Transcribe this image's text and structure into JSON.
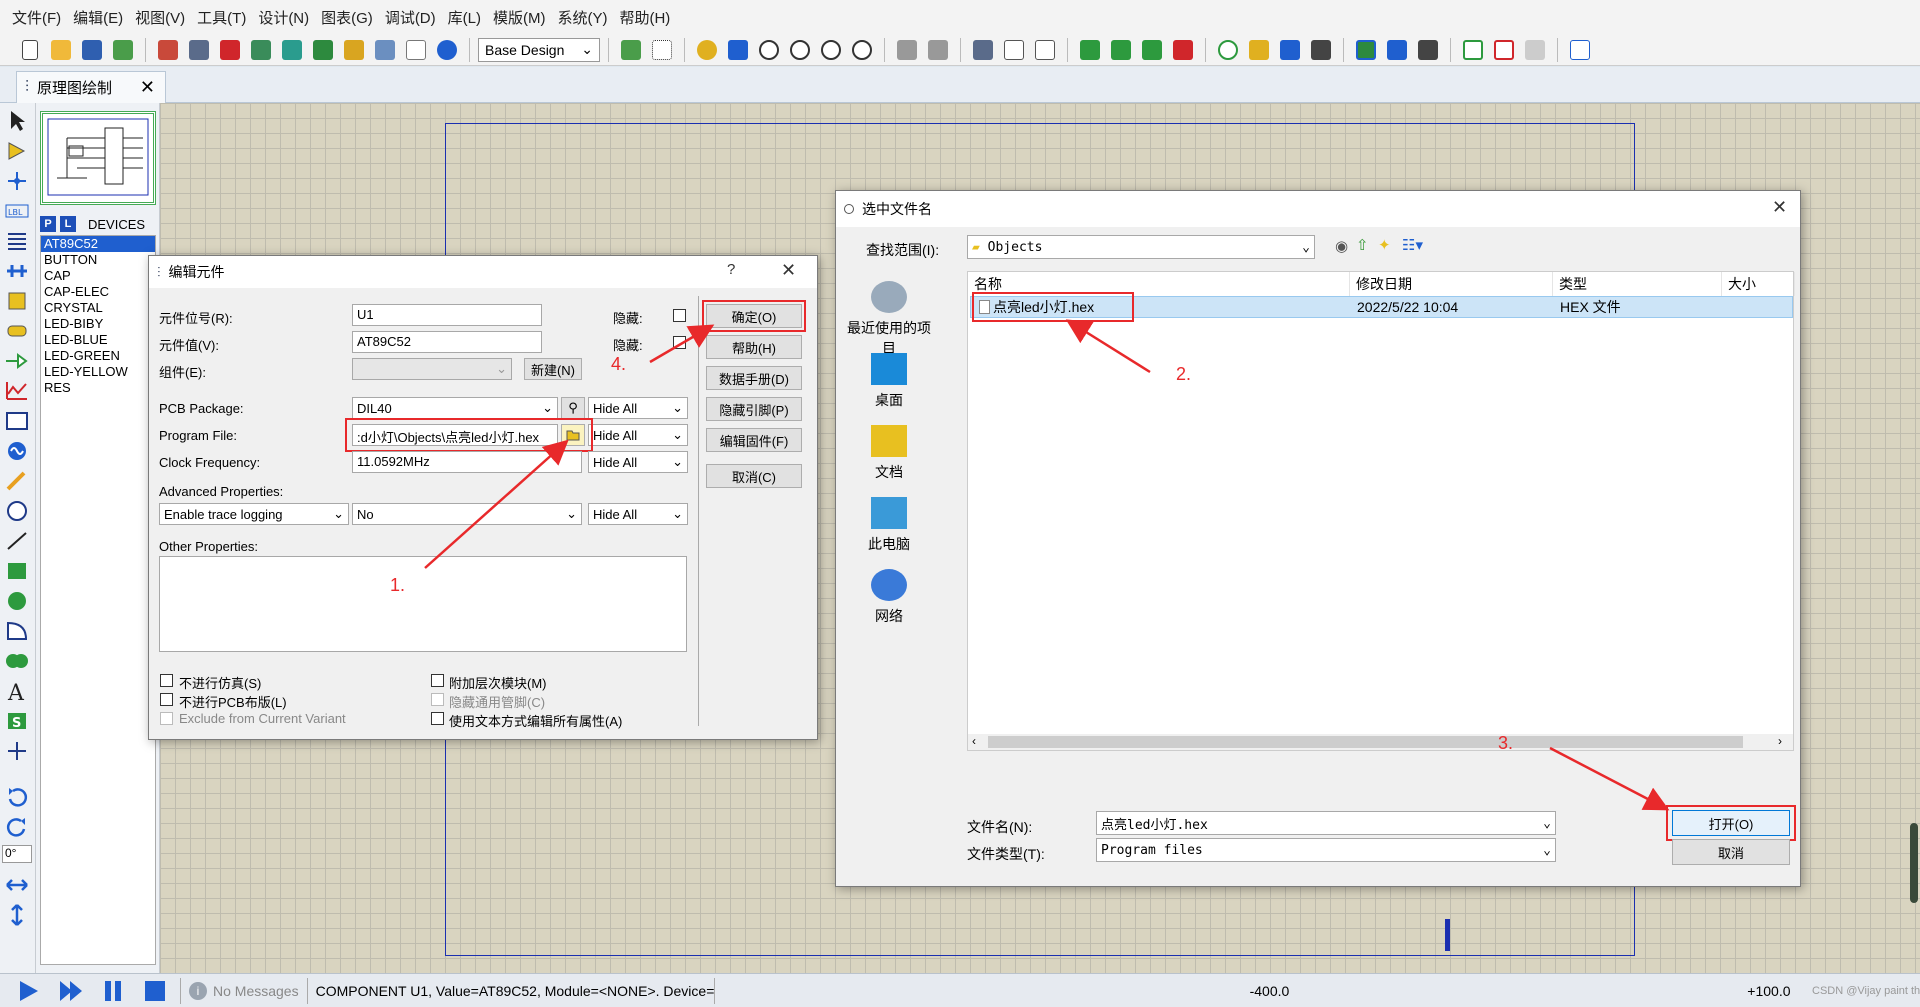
{
  "menu": [
    "文件(F)",
    "编辑(E)",
    "视图(V)",
    "工具(T)",
    "设计(N)",
    "图表(G)",
    "调试(D)",
    "库(L)",
    "模版(M)",
    "系统(Y)",
    "帮助(H)"
  ],
  "toolbar": {
    "design_select": "Base Design"
  },
  "tab": {
    "label": "原理图绘制"
  },
  "devices": {
    "header": "DEVICES",
    "p_label": "P",
    "l_label": "L",
    "items": [
      "AT89C52",
      "BUTTON",
      "CAP",
      "CAP-ELEC",
      "CRYSTAL",
      "LED-BIBY",
      "LED-BLUE",
      "LED-GREEN",
      "LED-YELLOW",
      "RES"
    ],
    "selected": "AT89C52"
  },
  "rotation_value": "0°",
  "status": {
    "messages": "No Messages",
    "component_info": "COMPONENT U1, Value=AT89C52, Module=<NONE>. Device=AT8",
    "coord_x": "-400.0",
    "coord_y": "+100.0",
    "watermark": "CSDN @Vijay paint th"
  },
  "edit_dialog": {
    "title": "编辑元件",
    "help": "?",
    "ref_label": "元件位号(R):",
    "ref_value": "U1",
    "val_label": "元件值(V):",
    "val_value": "AT89C52",
    "group_label": "组件(E):",
    "new_button": "新建(N)",
    "hide_label1": "隐藏:",
    "hide_label2": "隐藏:",
    "pcb_label": "PCB Package:",
    "pcb_value": "DIL40",
    "program_label": "Program File:",
    "program_value": ":d小灯\\Objects\\点亮led小灯.hex",
    "clock_label": "Clock Frequency:",
    "clock_value": "11.0592MHz",
    "adv_label": "Advanced Properties:",
    "adv_value": "Enable trace logging",
    "adv_option": "No",
    "hide_all": "Hide All",
    "other_label": "Other Properties:",
    "cb_no_sim": "不进行仿真(S)",
    "cb_no_pcb": "不进行PCB布版(L)",
    "cb_exclude": "Exclude from Current Variant",
    "cb_attach": "附加层次模块(M)",
    "cb_hide_pins": "隐藏通用管脚(C)",
    "cb_text_edit": "使用文本方式编辑所有属性(A)",
    "btn_ok": "确定(O)",
    "btn_help": "帮助(H)",
    "btn_datasheet": "数据手册(D)",
    "btn_hide_pins": "隐藏引脚(P)",
    "btn_firmware": "编辑固件(F)",
    "btn_cancel": "取消(C)"
  },
  "file_dialog": {
    "title": "选中文件名",
    "lookin_label": "查找范围(I):",
    "lookin_value": "Objects",
    "places": [
      "最近使用的项目",
      "桌面",
      "文档",
      "此电脑",
      "网络"
    ],
    "columns": [
      "名称",
      "修改日期",
      "类型",
      "大小"
    ],
    "files": [
      {
        "name": "点亮led小灯.hex",
        "date": "2022/5/22 10:04",
        "type": "HEX 文件",
        "size": ""
      }
    ],
    "filename_label": "文件名(N):",
    "filename_value": "点亮led小灯.hex",
    "filetype_label": "文件类型(T):",
    "filetype_value": "Program files",
    "btn_open": "打开(O)",
    "btn_cancel": "取消"
  },
  "annotations": [
    "1.",
    "2.",
    "3.",
    "4."
  ],
  "colors": {
    "highlight": "#e8292b",
    "selection": "#1f5fcf",
    "schematic_frame": "#1b2fb0"
  }
}
